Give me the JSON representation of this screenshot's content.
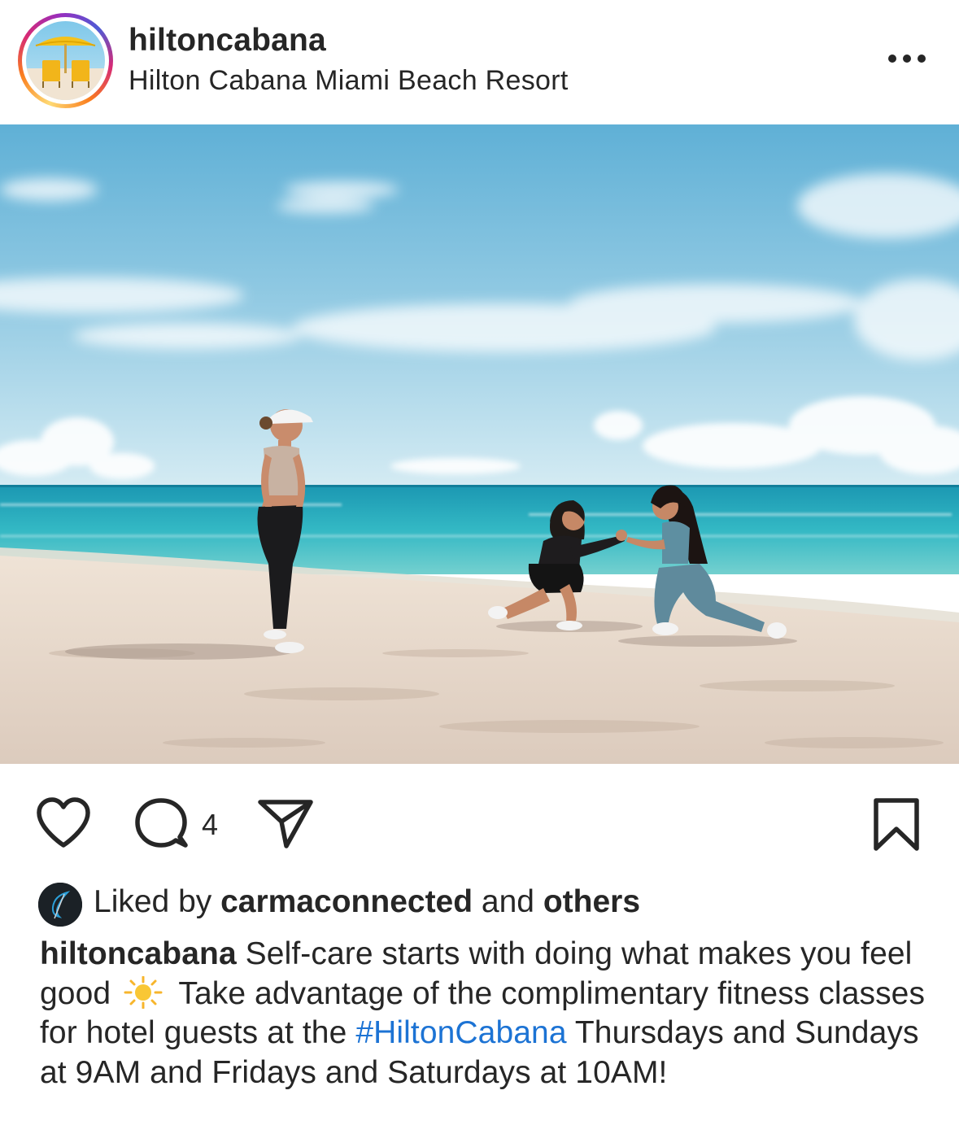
{
  "header": {
    "username": "hiltoncabana",
    "location": "Hilton Cabana Miami Beach Resort",
    "more_icon": "more-horizontal-icon"
  },
  "post": {
    "image_alt": "Three women exercising on a sandy beach by the ocean",
    "colors": {
      "sky_top": "#5fb0d6",
      "sea": "#2fb3c2",
      "sand": "#e9dccf"
    }
  },
  "actions": {
    "like_icon": "heart-icon",
    "comment_icon": "comment-icon",
    "comment_count": "4",
    "share_icon": "send-icon",
    "save_icon": "bookmark-icon"
  },
  "likes": {
    "prefix": "Liked by ",
    "user": "carmaconnected",
    "middle": " and ",
    "others": "others"
  },
  "caption": {
    "username": "hiltoncabana",
    "text_1": " Self-care starts with doing what makes you feel good ",
    "emoji": "sun-emoji",
    "text_2": " Take advantage of the complimentary fitness classes for hotel guests at the ",
    "hashtag": "#HiltonCabana",
    "text_3": " Thursdays and Sundays at 9AM and Fridays and Saturdays at 10AM!",
    "hashtag_color": "#1c73d4"
  }
}
